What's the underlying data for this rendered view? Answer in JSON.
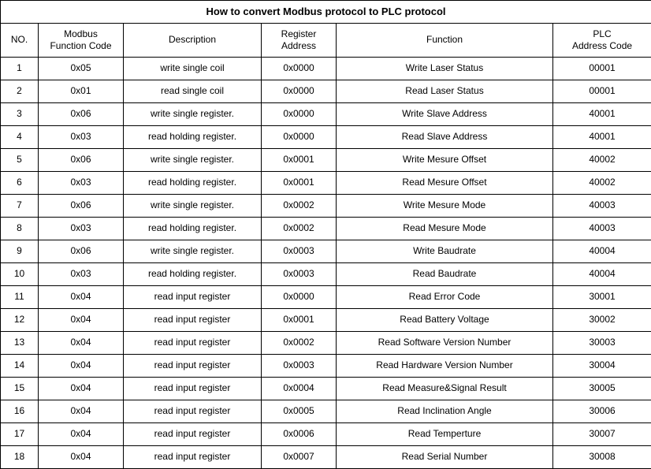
{
  "title": "How to convert Modbus protocol to PLC protocol",
  "headers": {
    "no": "NO.",
    "modbus_code": "Modbus\nFunction Code",
    "description": "Description",
    "register_address": "Register\nAddress",
    "function": "Function",
    "plc_address": "PLC\nAddress Code"
  },
  "rows": [
    {
      "no": "1",
      "modbus": "0x05",
      "desc": "write single coil",
      "reg": "0x0000",
      "func": "Write Laser Status",
      "plc": "00001"
    },
    {
      "no": "2",
      "modbus": "0x01",
      "desc": "read single coil",
      "reg": "0x0000",
      "func": "Read Laser Status",
      "plc": "00001"
    },
    {
      "no": "3",
      "modbus": "0x06",
      "desc": "write single register.",
      "reg": "0x0000",
      "func": "Write Slave Address",
      "plc": "40001"
    },
    {
      "no": "4",
      "modbus": "0x03",
      "desc": "read holding register.",
      "reg": "0x0000",
      "func": "Read Slave Address",
      "plc": "40001"
    },
    {
      "no": "5",
      "modbus": "0x06",
      "desc": "write single register.",
      "reg": "0x0001",
      "func": "Write Mesure Offset",
      "plc": "40002"
    },
    {
      "no": "6",
      "modbus": "0x03",
      "desc": "read holding register.",
      "reg": "0x0001",
      "func": "Read Mesure Offset",
      "plc": "40002"
    },
    {
      "no": "7",
      "modbus": "0x06",
      "desc": "write single register.",
      "reg": "0x0002",
      "func": "Write Mesure Mode",
      "plc": "40003"
    },
    {
      "no": "8",
      "modbus": "0x03",
      "desc": "read holding register.",
      "reg": "0x0002",
      "func": "Read Mesure Mode",
      "plc": "40003"
    },
    {
      "no": "9",
      "modbus": "0x06",
      "desc": "write single register.",
      "reg": "0x0003",
      "func": "Write Baudrate",
      "plc": "40004"
    },
    {
      "no": "10",
      "modbus": "0x03",
      "desc": "read holding register.",
      "reg": "0x0003",
      "func": "Read Baudrate",
      "plc": "40004"
    },
    {
      "no": "11",
      "modbus": "0x04",
      "desc": "read input register",
      "reg": "0x0000",
      "func": "Read Error Code",
      "plc": "30001"
    },
    {
      "no": "12",
      "modbus": "0x04",
      "desc": "read input register",
      "reg": "0x0001",
      "func": "Read Battery Voltage",
      "plc": "30002"
    },
    {
      "no": "13",
      "modbus": "0x04",
      "desc": "read input register",
      "reg": "0x0002",
      "func": "Read Software Version Number",
      "plc": "30003"
    },
    {
      "no": "14",
      "modbus": "0x04",
      "desc": "read input register",
      "reg": "0x0003",
      "func": "Read Hardware Version Number",
      "plc": "30004"
    },
    {
      "no": "15",
      "modbus": "0x04",
      "desc": "read input register",
      "reg": "0x0004",
      "func": "Read Measure&Signal Result",
      "plc": "30005"
    },
    {
      "no": "16",
      "modbus": "0x04",
      "desc": "read input register",
      "reg": "0x0005",
      "func": "Read Inclination Angle",
      "plc": "30006"
    },
    {
      "no": "17",
      "modbus": "0x04",
      "desc": "read input register",
      "reg": "0x0006",
      "func": "Read Temperture",
      "plc": "30007"
    },
    {
      "no": "18",
      "modbus": "0x04",
      "desc": "read input register",
      "reg": "0x0007",
      "func": "Read Serial Number",
      "plc": "30008"
    }
  ]
}
